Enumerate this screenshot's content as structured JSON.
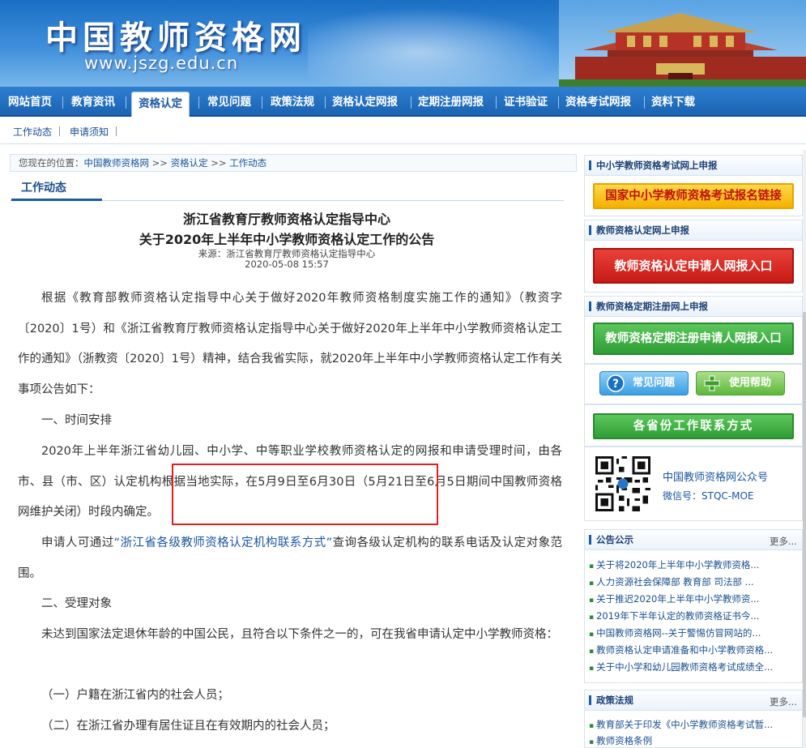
{
  "header": {
    "site_title": "中国教师资格网",
    "site_url": "www.jszg.edu.cn"
  },
  "main_nav": [
    {
      "label": "网站首页"
    },
    {
      "label": "教育资讯"
    },
    {
      "label": "资格认定",
      "active": true
    },
    {
      "label": "常见问题"
    },
    {
      "label": "政策法规"
    },
    {
      "label": "资格认定网报"
    },
    {
      "label": "定期注册网报"
    },
    {
      "label": "证书验证"
    },
    {
      "label": "资格考试网报"
    },
    {
      "label": "资料下载"
    }
  ],
  "sub_nav": [
    {
      "label": "工作动态"
    },
    {
      "label": "申请须知"
    }
  ],
  "breadcrumb": {
    "prefix": "您现在的位置：",
    "items": [
      "中国教师资格网",
      "资格认定",
      "工作动态"
    ],
    "separator": ">>"
  },
  "section": {
    "tab_label": "工作动态"
  },
  "article": {
    "title_line1": "浙江省教育厅教师资格认定指导中心",
    "title_line2": "关于2020年上半年中小学教师资格认定工作的公告",
    "source": "来源：浙江省教育厅教师资格认定指导中心",
    "date": "2020-05-08 15:57",
    "p1": "根据《教育部教师资格认定指导中心关于做好2020年教师资格制度实施工作的通知》（教资字〔2020〕1号）和《浙江省教育厅教师资格认定指导中心关于做好2020年上半年中小学教师资格认定工作的通知》（浙教资〔2020〕1号）精神，结合我省实际，就2020年上半年中小学教师资格认定工作有关事项公告如下：",
    "h1": "一、时间安排",
    "p2": "2020年上半年浙江省幼儿园、中小学、中等职业学校教师资格认定的网报和申请受理时间，由各市、县（市、区）认定机构根据当地实际，在5月9日至6月30日（5月21日至6月5日期间中国教师资格网维护关闭）时段内确定。",
    "p3_before": "申请人可通过",
    "p3_link": "“浙江省各级教师资格认定机构联系方式”",
    "p3_after": "查询各级认定机构的联系电话及认定对象范围。",
    "h2": "二、受理对象",
    "p4": "未达到国家法定退休年龄的中国公民，且符合以下条件之一的，可在我省申请认定中小学教师资格：",
    "item1": "（一）户籍在浙江省内的社会人员；",
    "item2": "（二）在浙江省办理有居住证且在有效期内的社会人员；"
  },
  "sidebar": {
    "exam_head": "中小学教师资格考试网上申报",
    "exam_btn": "国家中小学教师资格考试报名链接",
    "cert_head": "教师资格认定网上申报",
    "cert_btn": "教师资格认定申请人网报入口",
    "reg_head": "教师资格定期注册网上申报",
    "reg_btn": "教师资格定期注册申请人网报入口",
    "faq_btn": "常见问题",
    "help_btn": "使用帮助",
    "contacts_btn": "各省份工作联系方式",
    "wechat_title": "中国教师资格网公众号",
    "wechat_id": "微信号：STQC-MOE",
    "notice_head": "公告公示",
    "notice_more": "更多...",
    "notices": [
      "关于将2020年上半年中小学教师资格...",
      "人力资源社会保障部 教育部 司法部 ...",
      "关于推迟2020年上半年中小学教师资...",
      "2019年下半年认定的教师资格证书今...",
      "中国教师资格网--关于警惕仿冒网站的...",
      "教师资格认定申请准备和中小学教师资格...",
      "关于中小学和幼儿园教师资格考试成绩全..."
    ],
    "policy_head": "政策法规",
    "policy_more": "更多...",
    "policies": [
      "教育部关于印发《中小学教师资格考试暂...",
      "教师资格条例"
    ]
  }
}
